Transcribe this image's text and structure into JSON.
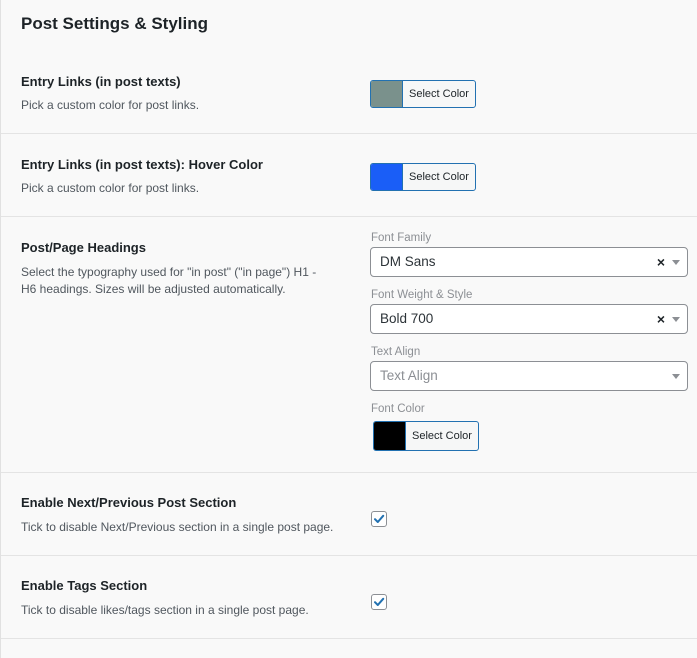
{
  "section": {
    "title": "Post Settings & Styling"
  },
  "entry_links": {
    "label": "Entry Links (in post texts)",
    "description": "Pick a custom color for post links.",
    "button_label": "Select Color",
    "color": "#7a918c"
  },
  "entry_links_hover": {
    "label": "Entry Links (in post texts): Hover Color",
    "description": "Pick a custom color for post links.",
    "button_label": "Select Color",
    "color": "#1a5ef7"
  },
  "headings": {
    "label": "Post/Page Headings",
    "description_line1": "Select the typography used for \"in post\" (\"in page\") H1 -",
    "description_line2": "H6 headings. Sizes will be adjusted automatically.",
    "font_family": {
      "label": "Font Family",
      "value": "DM Sans",
      "clear": "×"
    },
    "font_weight": {
      "label": "Font Weight & Style",
      "value": "Bold 700",
      "clear": "×"
    },
    "text_align": {
      "label": "Text Align",
      "placeholder": "Text Align"
    },
    "font_color": {
      "label": "Font Color",
      "button_label": "Select Color",
      "color": "#000000"
    }
  },
  "next_prev": {
    "label": "Enable Next/Previous Post Section",
    "description": "Tick to disable Next/Previous section in a single post page.",
    "checked": true
  },
  "tags": {
    "label": "Enable Tags Section",
    "description": "Tick to disable likes/tags section in a single post page.",
    "checked": true
  },
  "colors": {
    "accent": "#2271b1",
    "checkmark": "#2271b1"
  }
}
